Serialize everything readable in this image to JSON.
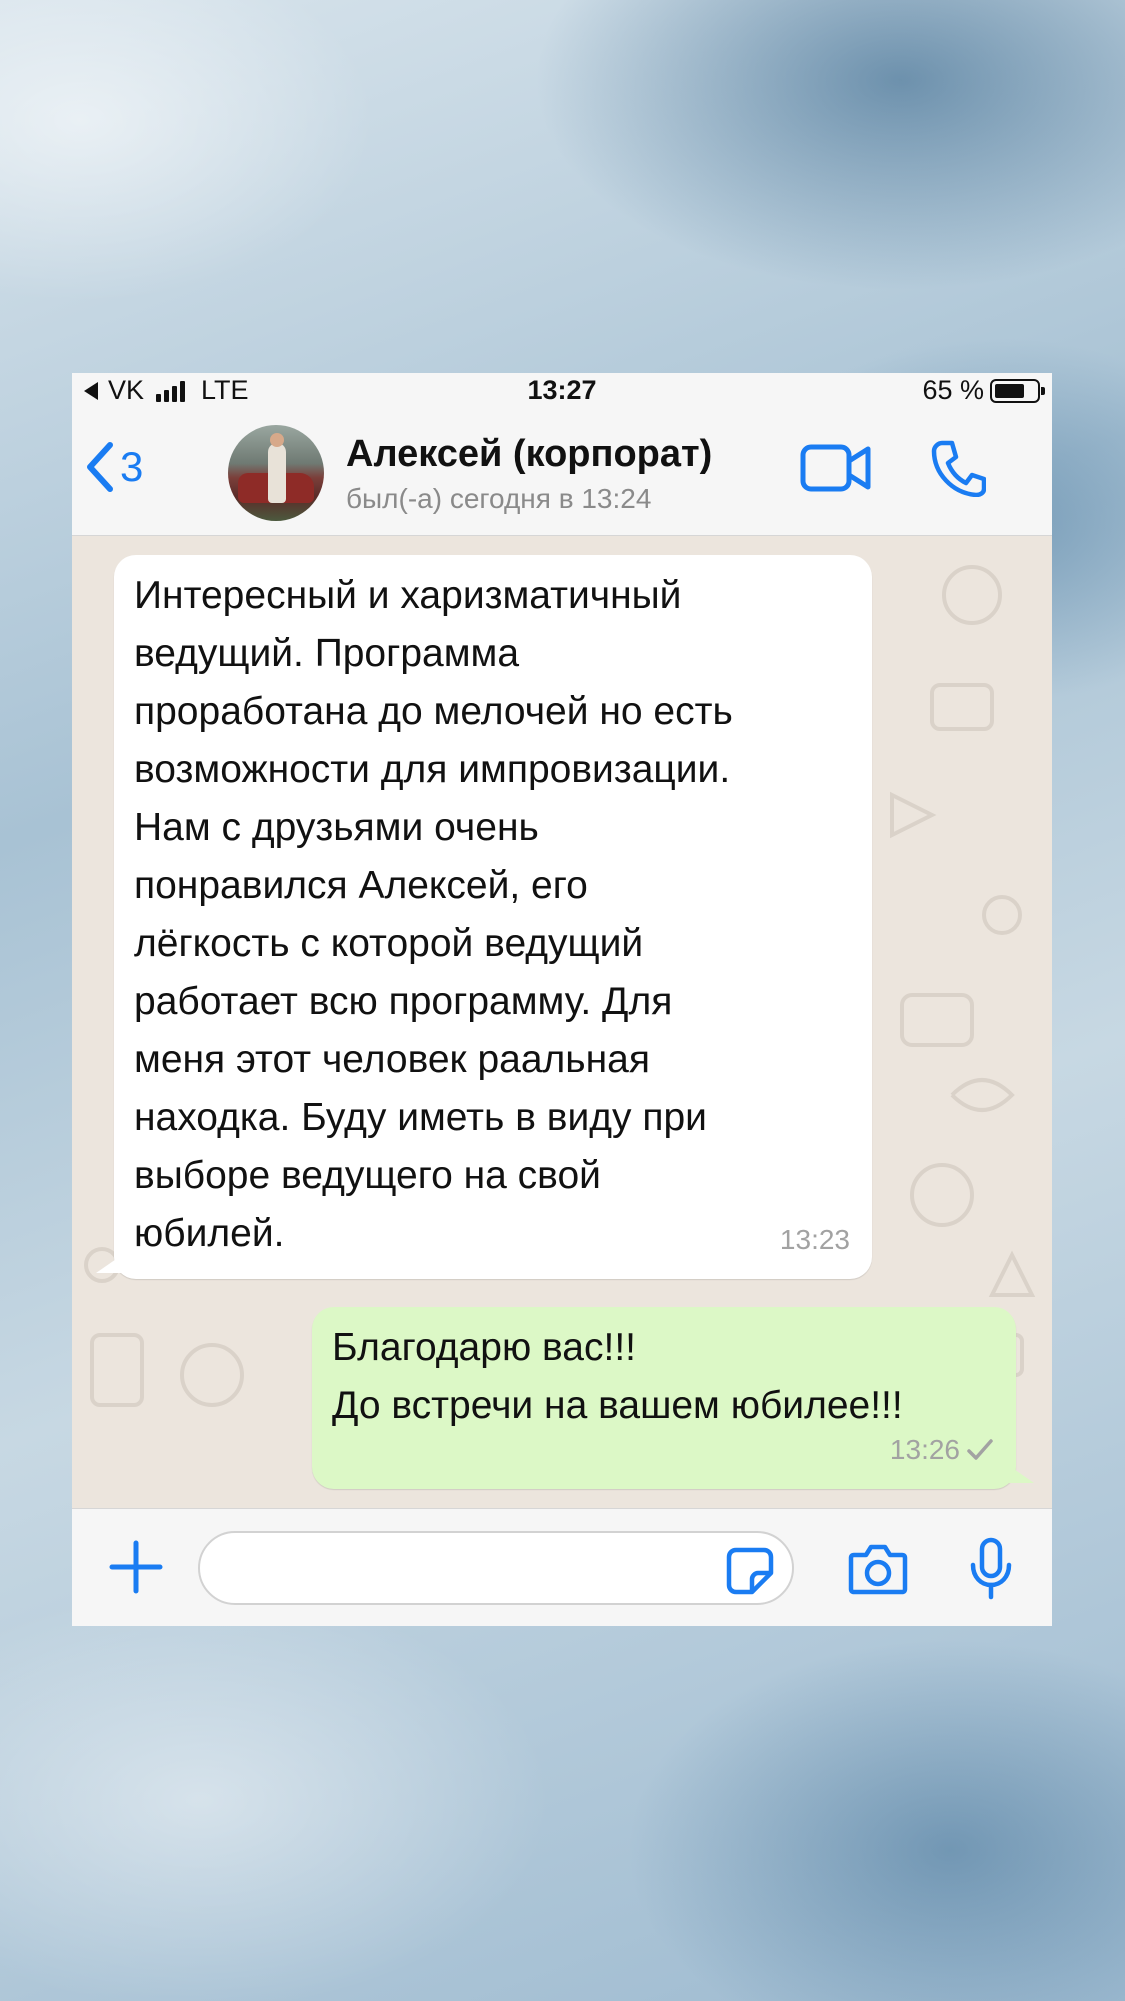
{
  "status_bar": {
    "carrier": "VK",
    "network": "LTE",
    "time": "13:27",
    "battery": "65 %"
  },
  "header": {
    "back_count": "3",
    "contact_name": "Алексей (корпорат)",
    "contact_status": "был(-а) сегодня в 13:24"
  },
  "messages": [
    {
      "direction": "incoming",
      "text": "Интересный и харизматичный\nведущий. Программа\nпроработана до мелочей но есть\nвозможности для импровизации.\nНам с друзьями очень\nпонравился Алексей, его\nлёгкость с которой ведущий\nработает всю программу. Для\nменя этот человек раальная\nнаходка. Буду иметь в виду при\nвыборе ведущего на свой\nюбилей.",
      "time": "13:23"
    },
    {
      "direction": "outgoing",
      "text": "Благодарю вас!!!\nДо встречи на вашем юбилее!!!",
      "time": "13:26",
      "status": "delivered"
    }
  ],
  "composer": {
    "value": "",
    "placeholder": ""
  },
  "colors": {
    "accent": "#1a7cf2",
    "incoming_bubble": "#ffffff",
    "outgoing_bubble": "#dcf8c6",
    "chat_background": "#ece5dd"
  },
  "icons": [
    "back-chevron-icon",
    "video-call-icon",
    "phone-icon",
    "plus-icon",
    "sticker-icon",
    "camera-icon",
    "microphone-icon",
    "checkmark-icon",
    "signal-icon",
    "battery-icon",
    "location-arrow-icon"
  ]
}
